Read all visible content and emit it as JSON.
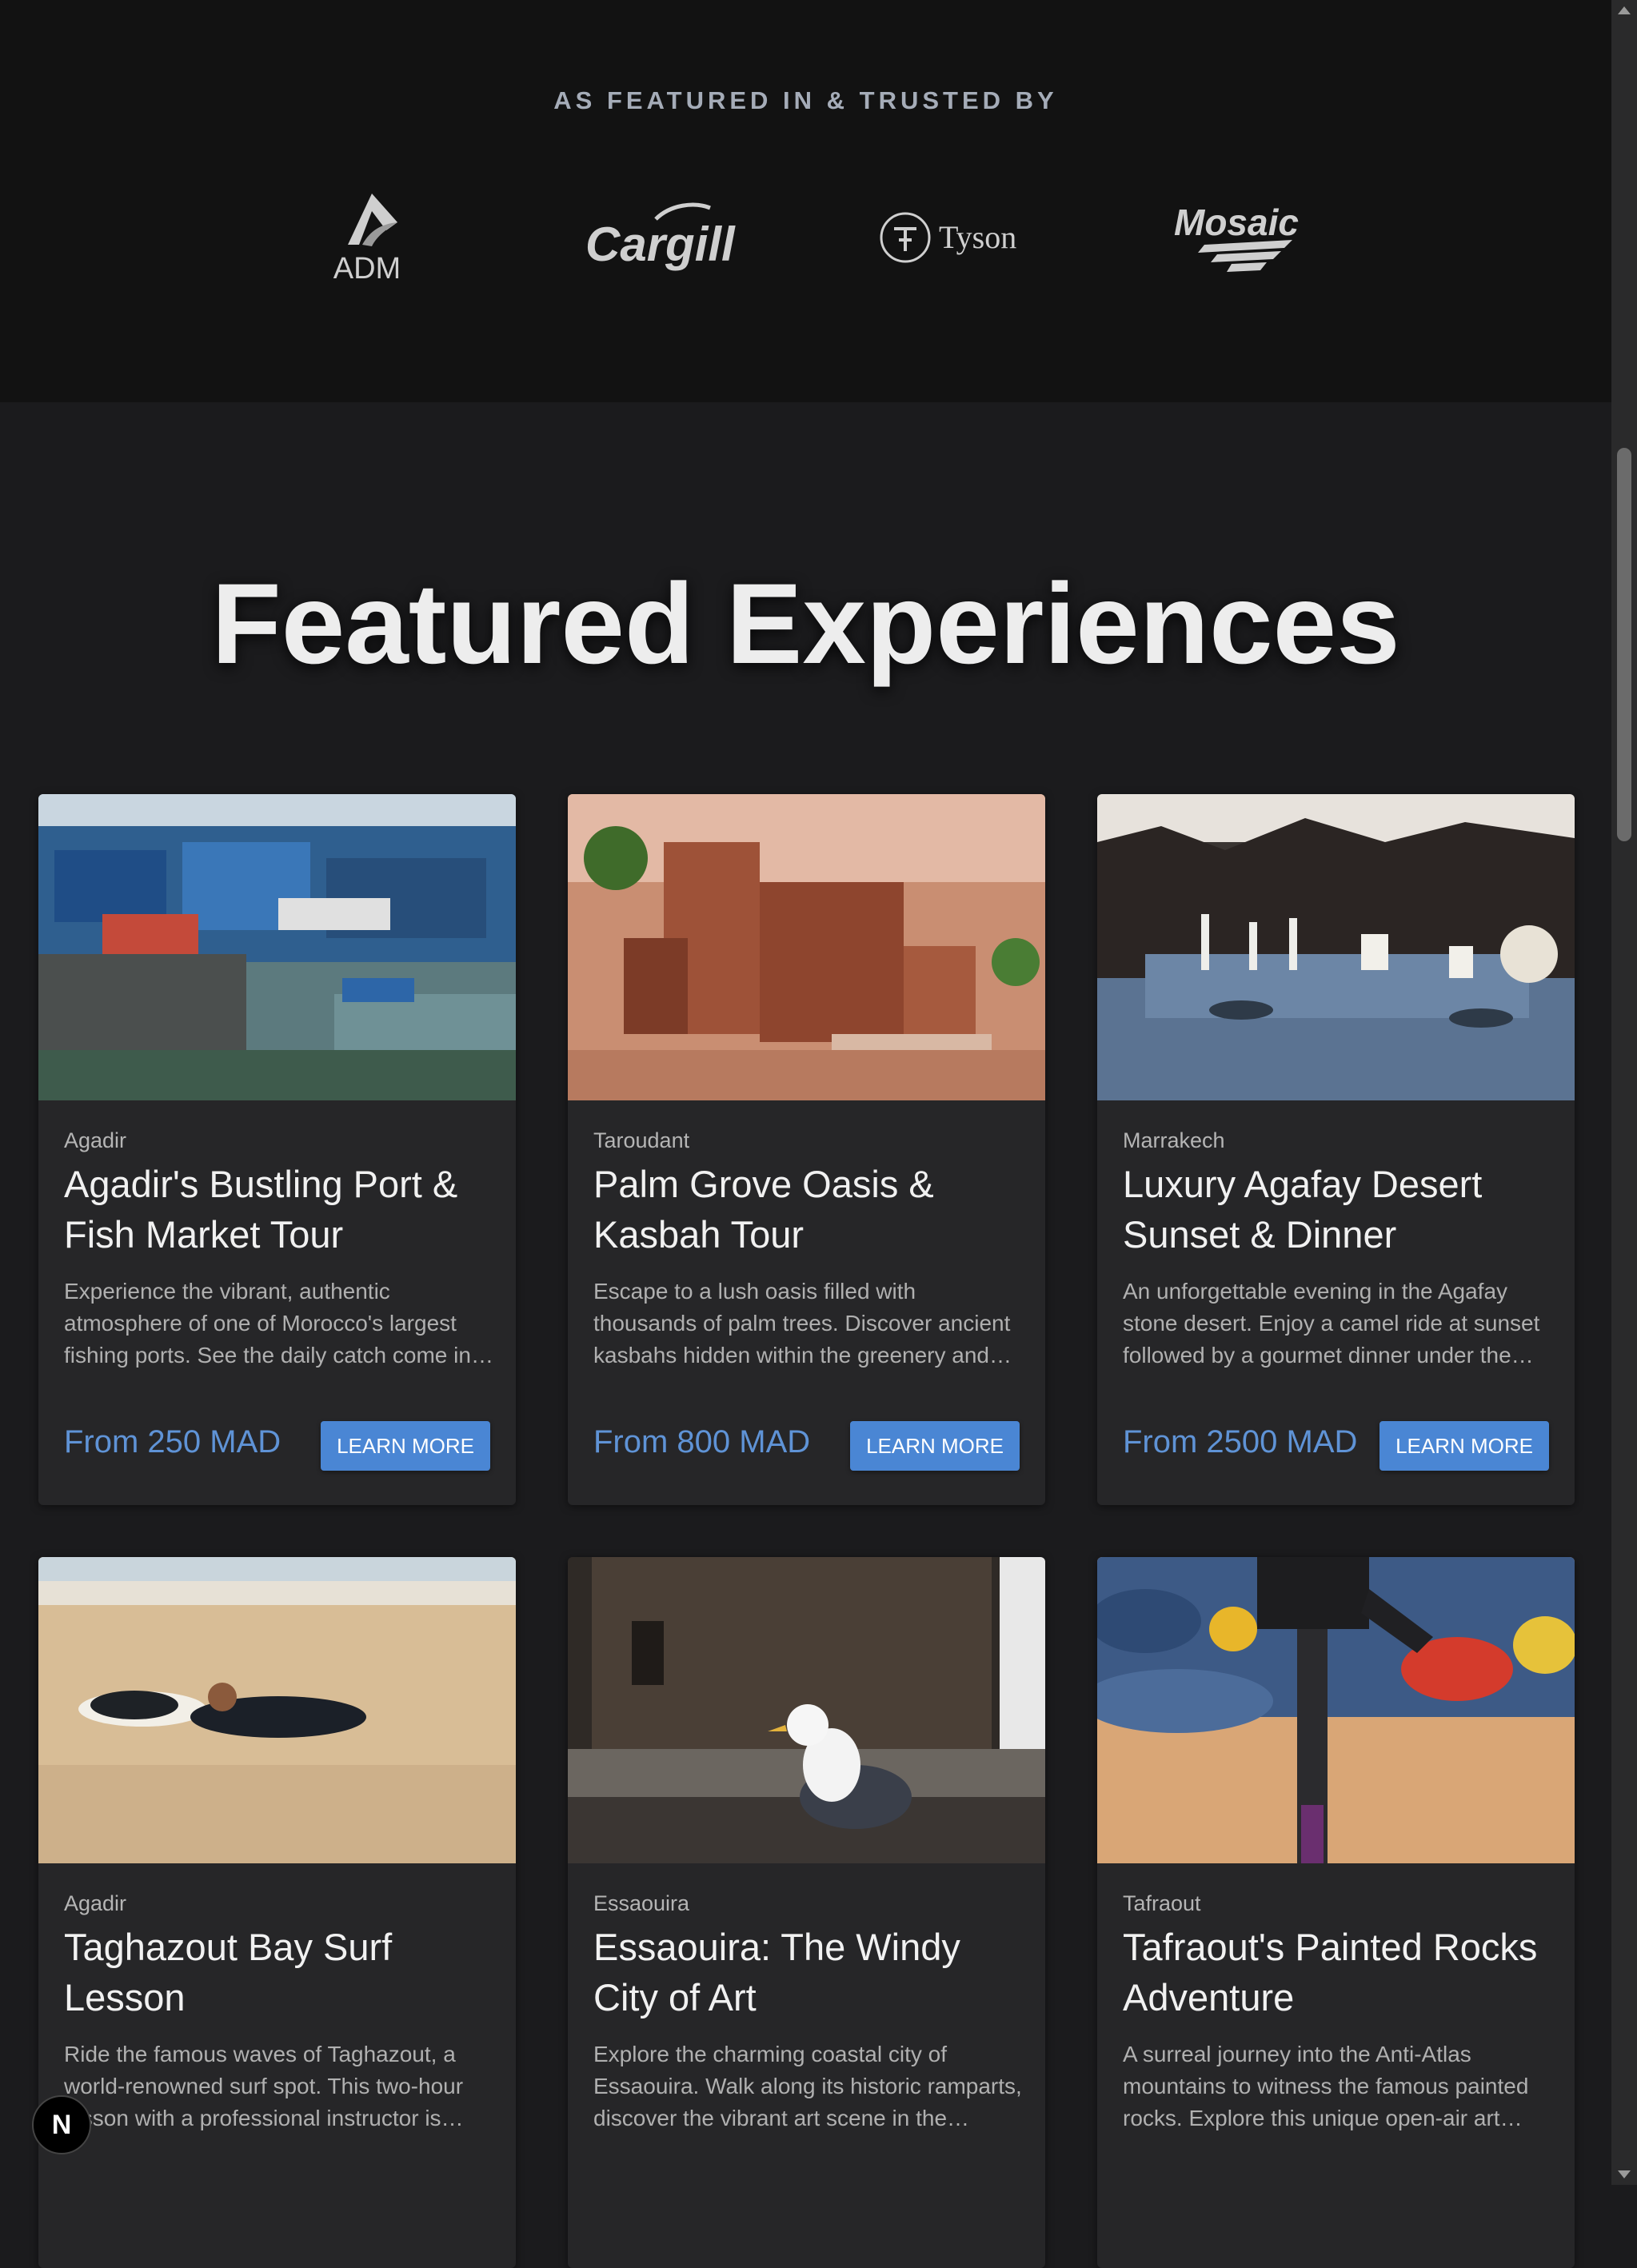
{
  "trusted": {
    "title": "AS FEATURED IN & TRUSTED BY",
    "logos": [
      "ADM",
      "Cargill",
      "Tyson",
      "Mosaic"
    ]
  },
  "featured": {
    "title": "Featured Experiences",
    "cards": [
      {
        "location": "Agadir",
        "title": "Agadir's Bustling Port & Fish Market Tour",
        "description": "Experience the vibrant, authentic atmosphere of one of Morocco's largest fishing ports. See the daily catch come in and witness the busy life of the harbor.",
        "price": "From 250 MAD",
        "button": "LEARN MORE"
      },
      {
        "location": "Taroudant",
        "title": "Palm Grove Oasis & Kasbah Tour",
        "description": "Escape to a lush oasis filled with thousands of palm trees. Discover ancient kasbahs hidden within the greenery and learn about traditional life.",
        "price": "From 800 MAD",
        "button": "LEARN MORE"
      },
      {
        "location": "Marrakech",
        "title": "Luxury Agafay Desert Sunset & Dinner",
        "description": "An unforgettable evening in the Agafay stone desert. Enjoy a camel ride at sunset followed by a gourmet dinner under the stars.",
        "price": "From 2500 MAD",
        "button": "LEARN MORE"
      },
      {
        "location": "Agadir",
        "title": "Taghazout Bay Surf Lesson",
        "description": "Ride the famous waves of Taghazout, a world-renowned surf spot. This two-hour lesson with a professional instructor is perfect for beginners.",
        "price": "",
        "button": ""
      },
      {
        "location": "Essaouira",
        "title": "Essaouira: The Windy City of Art",
        "description": "Explore the charming coastal city of Essaouira. Walk along its historic ramparts, discover the vibrant art scene in the medina.",
        "price": "",
        "button": ""
      },
      {
        "location": "Tafraout",
        "title": "Tafraout's Painted Rocks Adventure",
        "description": "A surreal journey into the Anti-Atlas mountains to witness the famous painted rocks. Explore this unique open-air art installation.",
        "price": "",
        "button": ""
      }
    ]
  },
  "badge": {
    "label": "N"
  },
  "colors": {
    "accent": "#4a86d4",
    "price": "#5f93d6",
    "background": "#1b1b1d"
  }
}
